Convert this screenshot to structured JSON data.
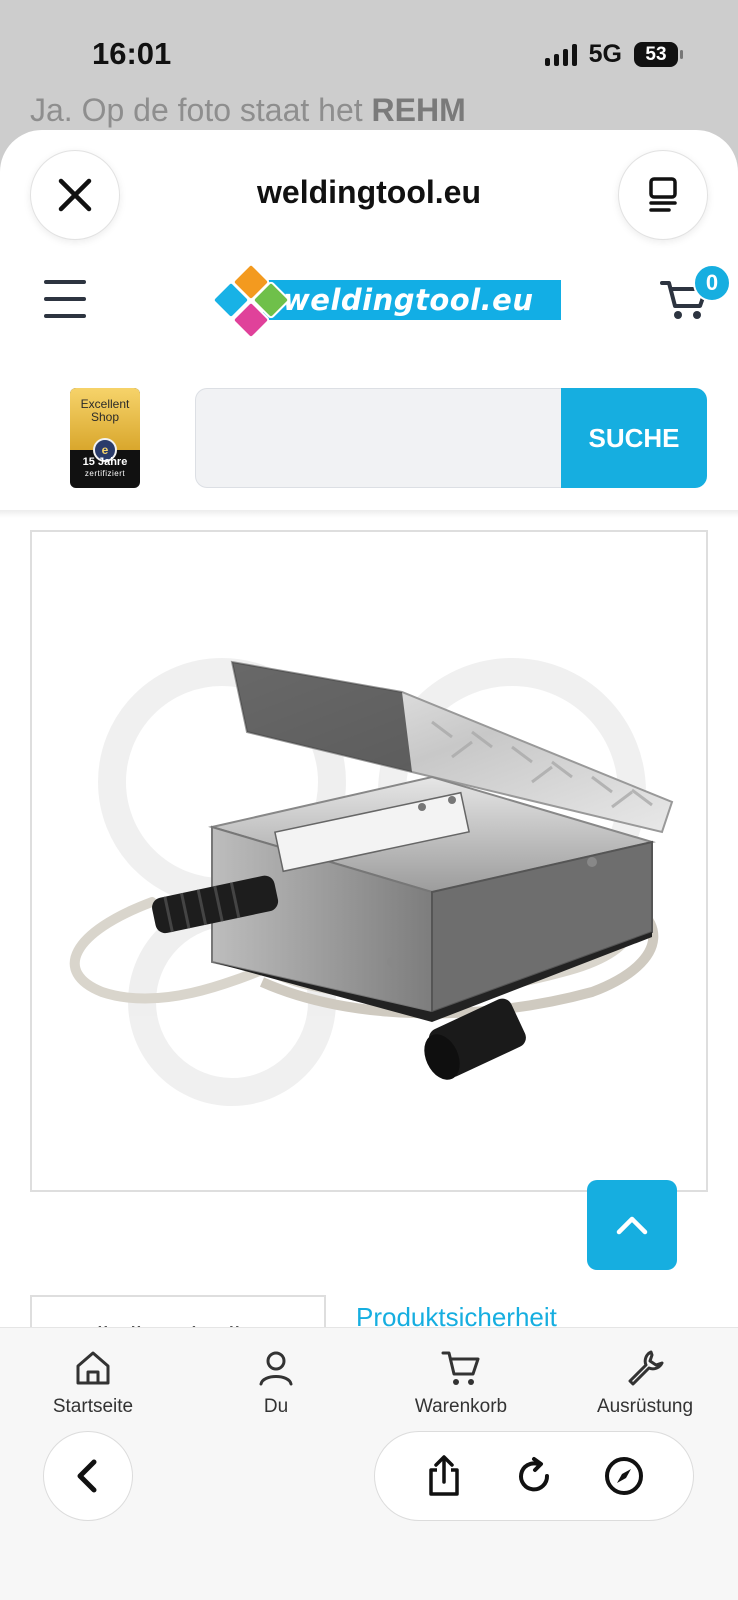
{
  "status_bar": {
    "time": "16:01",
    "network": "5G",
    "battery": "53"
  },
  "background_page": {
    "peek_text_prefix": "Ja. Op de foto staat het ",
    "peek_text_bold": "REHM"
  },
  "sheet": {
    "site_title": "weldingtool.eu",
    "close_icon": "close-icon",
    "menu_icon": "stack-icon"
  },
  "header": {
    "logo_text": "weldingtool.eu",
    "cart_count": "0"
  },
  "trust_badge": {
    "line1": "Excellent",
    "line2": "Shop",
    "seal": "e",
    "years": "15 Jahre",
    "certified": "zertifiziert"
  },
  "search": {
    "placeholder": "",
    "button_label": "SUCHE"
  },
  "tabs": {
    "active": "Artikelbeschreibung",
    "other": "Produktsicherheit"
  },
  "bottom_nav": {
    "items": [
      {
        "label": "Startseite",
        "icon": "home-icon"
      },
      {
        "label": "Du",
        "icon": "user-icon"
      },
      {
        "label": "Warenkorb",
        "icon": "cart-icon"
      },
      {
        "label": "Ausrüstung",
        "icon": "wrench-icon"
      }
    ]
  },
  "colors": {
    "accent": "#16aee0",
    "text_dark": "#111111",
    "tab_text": "#555555"
  }
}
